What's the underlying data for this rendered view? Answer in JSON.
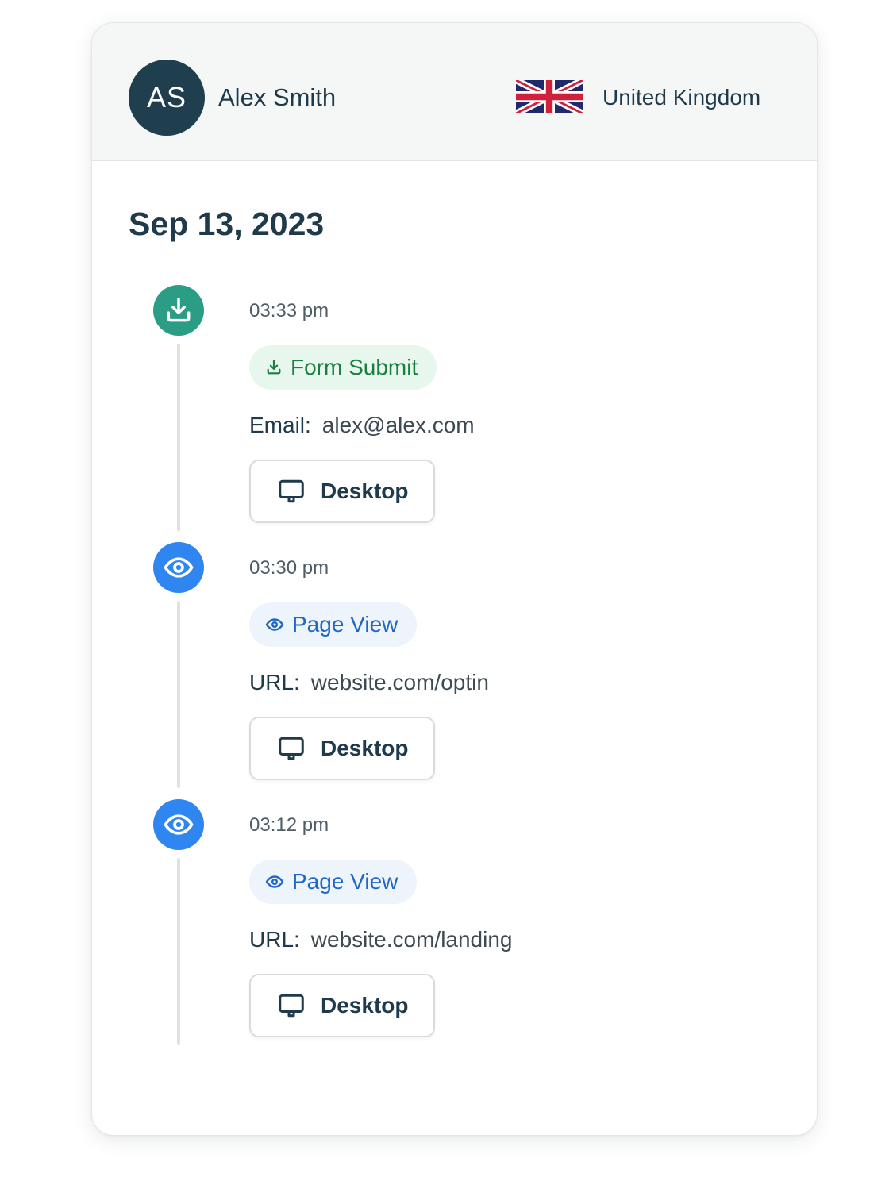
{
  "profile": {
    "initials": "AS",
    "name": "Alex Smith",
    "country": "United Kingdom",
    "flag_icon": "uk-flag-icon"
  },
  "date": "Sep 13, 2023",
  "colors": {
    "avatar_bg": "#203f4e",
    "form_submit_accent": "#2a9d84",
    "page_view_accent": "#2f86f0"
  },
  "events": [
    {
      "time": "03:33 pm",
      "type_label": "Form Submit",
      "type_icon": "download-icon",
      "detail_label": "Email:",
      "detail_value": "alex@alex.com",
      "device": "Desktop",
      "device_icon": "monitor-icon"
    },
    {
      "time": "03:30 pm",
      "type_label": "Page View",
      "type_icon": "eye-icon",
      "detail_label": "URL:",
      "detail_value": "website.com/optin",
      "device": "Desktop",
      "device_icon": "monitor-icon"
    },
    {
      "time": "03:12 pm",
      "type_label": "Page View",
      "type_icon": "eye-icon",
      "detail_label": "URL:",
      "detail_value": "website.com/landing",
      "device": "Desktop",
      "device_icon": "monitor-icon"
    }
  ]
}
